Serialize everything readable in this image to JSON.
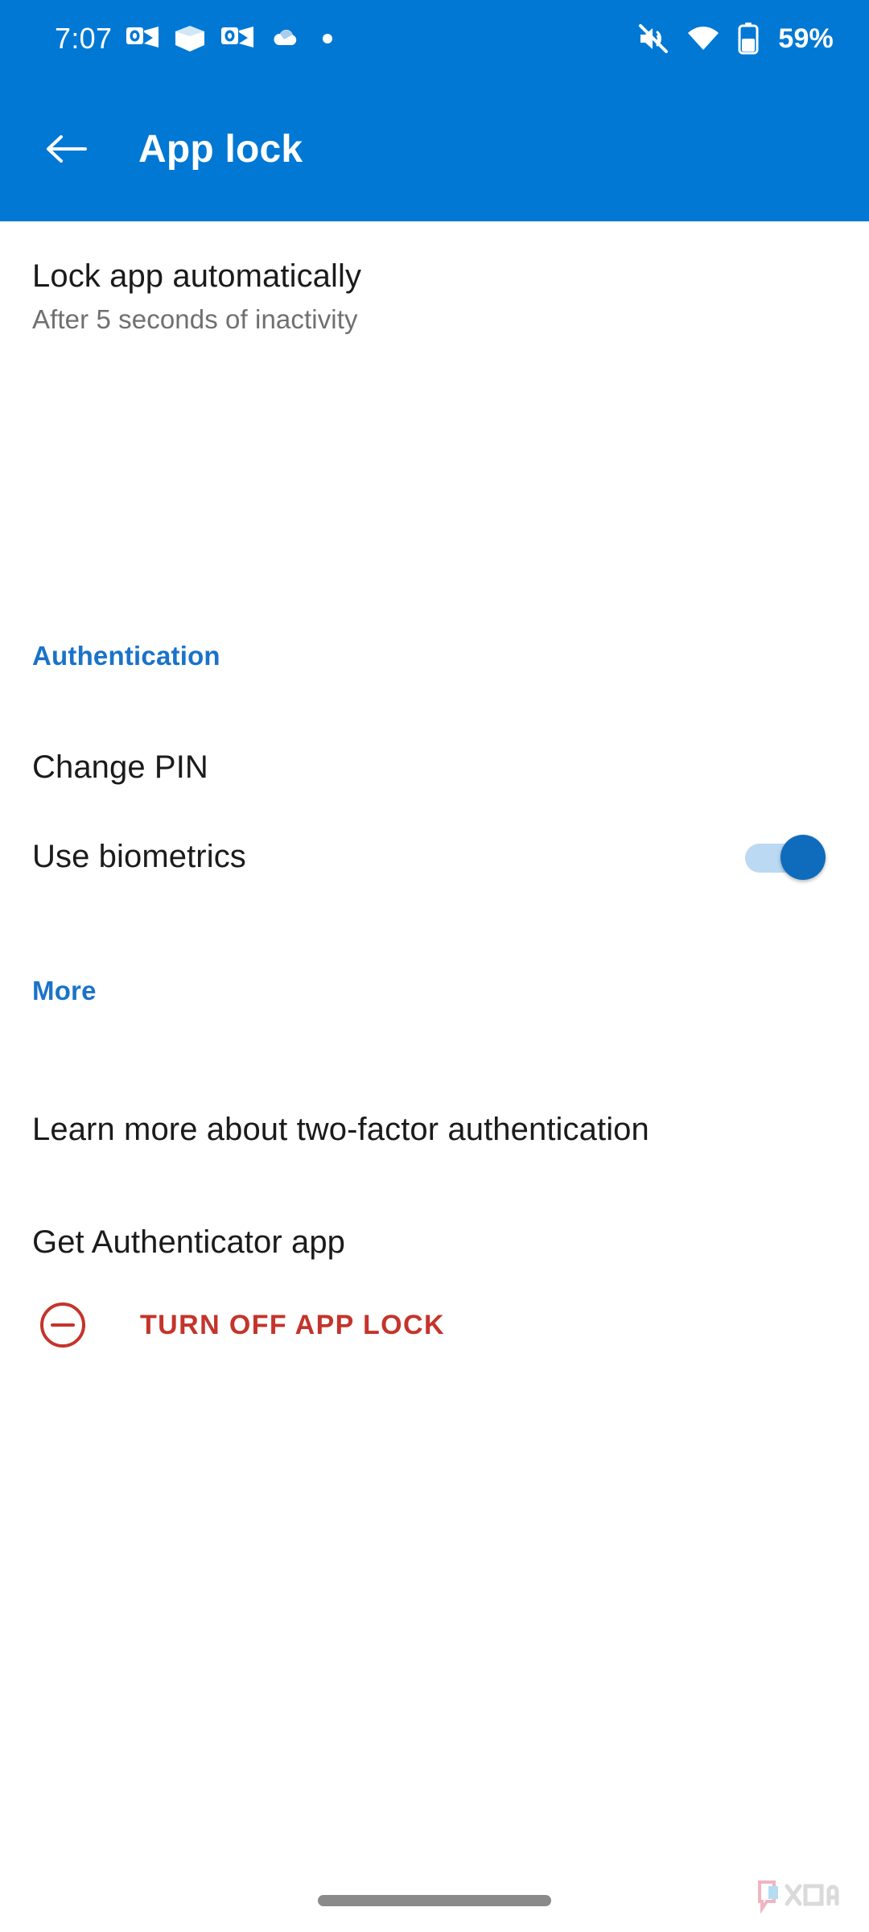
{
  "status_bar": {
    "time": "7:07",
    "battery_percent": "59%",
    "notification_icons": [
      "outlook-icon",
      "office-cube-icon",
      "outlook-icon",
      "onedrive-cloud-icon",
      "notification-dot-icon"
    ],
    "system_icons": [
      "mute-icon",
      "wifi-icon",
      "battery-icon"
    ]
  },
  "app_bar": {
    "back_icon": "back-arrow-icon",
    "title": "App lock"
  },
  "settings": {
    "auto_lock": {
      "title": "Lock app automatically",
      "subtitle": "After 5 seconds of inactivity"
    },
    "sections": [
      {
        "header": "Authentication",
        "items": [
          {
            "label": "Change PIN"
          },
          {
            "label": "Use biometrics",
            "toggle": "on"
          }
        ]
      },
      {
        "header": "More",
        "items": [
          {
            "label": "Learn more about two-factor authentication"
          },
          {
            "label": "Get Authenticator app"
          }
        ]
      }
    ],
    "turn_off": {
      "icon": "minus-circle-icon",
      "label": "TURN OFF APP LOCK"
    }
  },
  "colors": {
    "header_blue": "#0078D4",
    "section_blue": "#1A73C8",
    "danger_red": "#C4342B",
    "toggle_on": "#0F6CBD",
    "toggle_track": "#BBD9F2",
    "primary_text": "#1B1B1B",
    "secondary_text": "#707070"
  },
  "navigation": {
    "gesture_pill": "home-gesture-pill",
    "watermark": "XDA"
  }
}
